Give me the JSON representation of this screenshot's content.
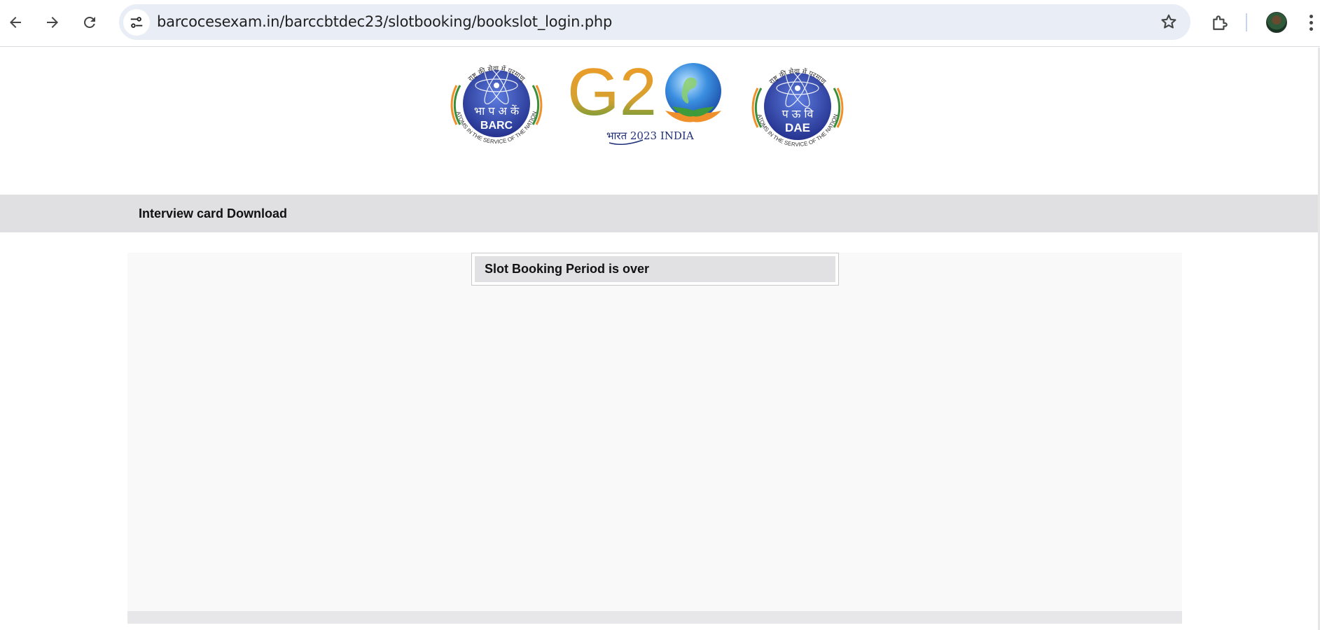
{
  "browser": {
    "url": "barcocesexam.in/barccbtdec23/slotbooking/bookslot_login.php",
    "icons": {
      "back": "arrow-back-icon",
      "forward": "arrow-forward-icon",
      "reload": "reload-icon",
      "site_info": "tune-icon",
      "bookmark": "star-icon",
      "extensions": "puzzle-icon",
      "menu": "kebab-menu-icon"
    }
  },
  "header": {
    "logos": {
      "barc": {
        "arc_text": "राष्ट्र की सेवा में परमाणु",
        "center_hindi": "भा प अ कें",
        "center_label": "BARC",
        "bottom_arc": "ATOMS IN THE SERVICE OF THE NATION"
      },
      "g20": {
        "label": "G2",
        "subtitle": "भारत 2023 INDIA"
      },
      "dae": {
        "arc_text": "राष्ट्र की सेवा में परमाणु",
        "center_hindi": "प ऊ वि",
        "center_label": "DAE",
        "bottom_arc": "ATOMS IN THE SERVICE OF THE NATION"
      }
    }
  },
  "nav": {
    "interview_card_link": "Interview card Download"
  },
  "main": {
    "notice": "Slot Booking Period is over"
  },
  "colors": {
    "toolbar_bg": "#ffffff",
    "omnibox_bg": "#e9edf6",
    "menubar_bg": "#e0e0e2",
    "content_bg": "#f9f9f9",
    "emblem_blue": "#2f3e9e",
    "saffron": "#f0902a",
    "green": "#3a8f3a"
  }
}
